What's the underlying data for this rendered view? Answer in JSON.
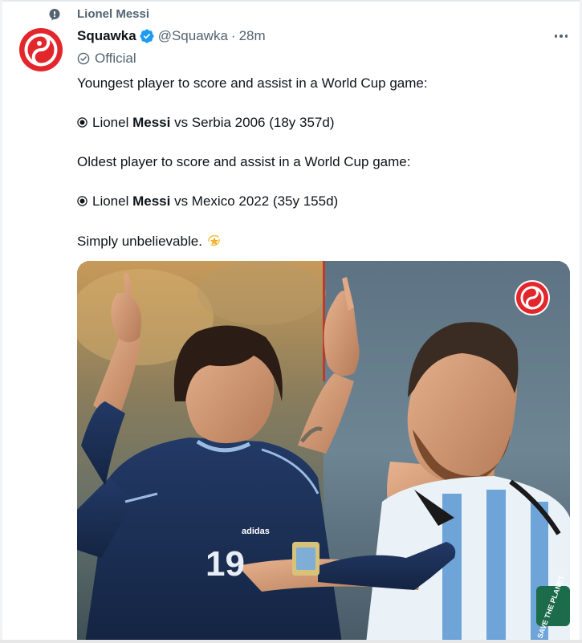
{
  "context": {
    "label": "Lionel Messi",
    "icon": "topic-bubble-icon"
  },
  "tweet": {
    "display_name": "Squawka",
    "handle": "@Squawka",
    "separator": "·",
    "time": "28m",
    "verified_icon": "verified-badge-icon",
    "official_label": "Official",
    "more_icon": "more-dots-icon",
    "text": {
      "line1": "Youngest player to score and assist in a World Cup game:",
      "line2_prefix": "Lionel ",
      "line2_bold": "Messi",
      "line2_suffix": " vs Serbia 2006 (18y 357d)",
      "line3": "Oldest player to score and assist in a World Cup game:",
      "line4_prefix": "Lionel ",
      "line4_bold": "Messi",
      "line4_suffix": " vs Mexico 2022 (35y 155d)",
      "line5": "Simply unbelievable."
    },
    "emoji": "dizzy-star-emoji",
    "media": {
      "left_shirt_number": "19",
      "left_shirt_brand": "adidas",
      "right_sleeve_text": "SAVE THE PLANET"
    }
  },
  "colors": {
    "brand": "#e3262b",
    "verified": "#1d9bf0",
    "text_primary": "#0f1419",
    "text_secondary": "#536471"
  }
}
